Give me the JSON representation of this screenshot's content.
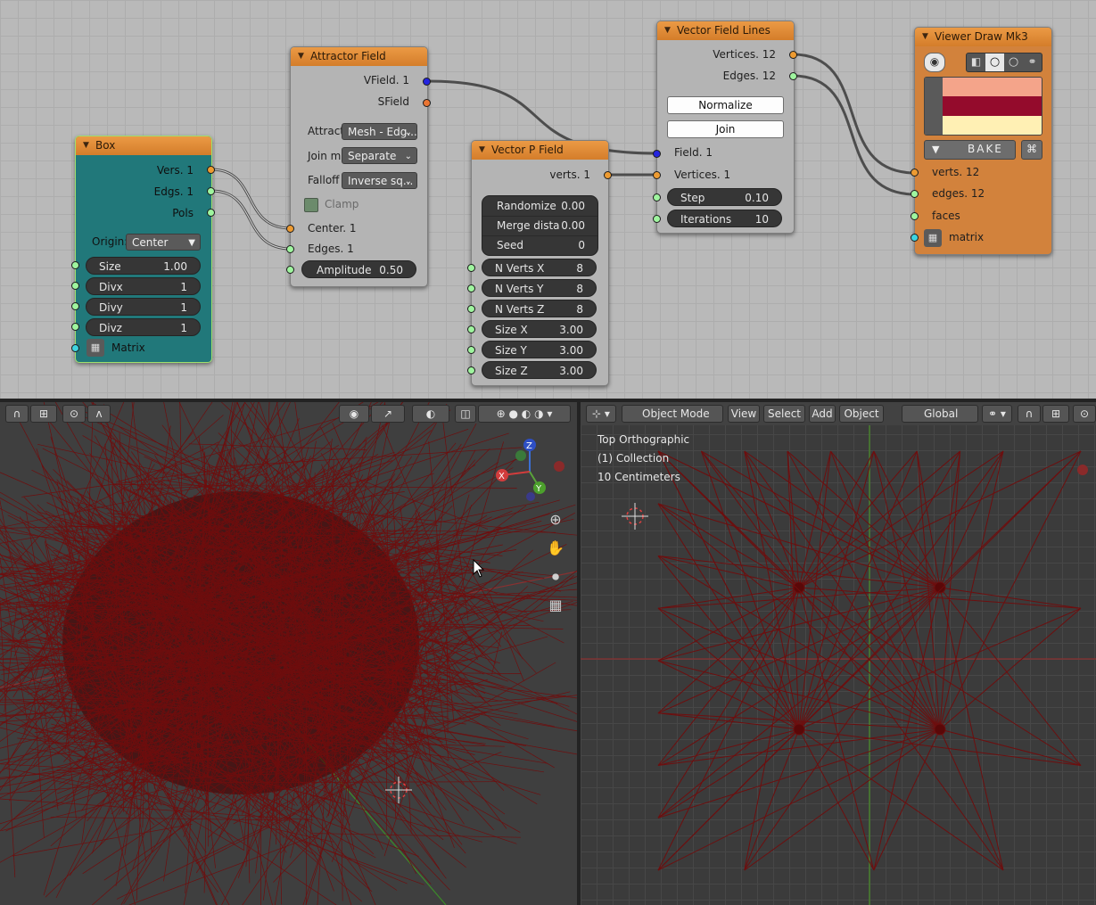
{
  "colors": {
    "node_header": "#e0893a",
    "box_body": "#21787a",
    "viewer_body": "#d2823c",
    "wire": "#5a5a5a",
    "mesh_wire": "#6e0e0e",
    "swatch_vertex": "#f4a48a",
    "swatch_edge": "#940b2c",
    "swatch_face": "#fff0b4"
  },
  "nodes": {
    "box": {
      "title": "Box",
      "outputs": [
        "Vers. 1",
        "Edgs. 1",
        "Pols"
      ],
      "origin_label": "Origin:",
      "origin_value": "Center",
      "fields": [
        {
          "label": "Size",
          "value": "1.00"
        },
        {
          "label": "Divx",
          "value": "1"
        },
        {
          "label": "Divy",
          "value": "1"
        },
        {
          "label": "Divz",
          "value": "1"
        }
      ],
      "matrix_label": "Matrix"
    },
    "attractor": {
      "title": "Attractor Field",
      "outputs": [
        "VField. 1",
        "SField"
      ],
      "attract_label": "Attract",
      "attract_value": "Mesh - Edg...",
      "join_label": "Join m",
      "join_value": "Separate",
      "falloff_label": "Falloff",
      "falloff_value": "Inverse sq...",
      "clamp_label": "Clamp",
      "inputs": [
        "Center. 1",
        "Edges. 1"
      ],
      "amplitude_label": "Amplitude",
      "amplitude_value": "0.50"
    },
    "vpfield": {
      "title": "Vector P Field",
      "output": "verts. 1",
      "props": [
        {
          "label": "Randomize",
          "value": "0.00"
        },
        {
          "label": "Merge dista",
          "value": "0.00"
        },
        {
          "label": "Seed",
          "value": "0"
        }
      ],
      "fields": [
        {
          "label": "N Verts X",
          "value": "8"
        },
        {
          "label": "N Verts Y",
          "value": "8"
        },
        {
          "label": "N Verts Z",
          "value": "8"
        },
        {
          "label": "Size X",
          "value": "3.00"
        },
        {
          "label": "Size Y",
          "value": "3.00"
        },
        {
          "label": "Size Z",
          "value": "3.00"
        }
      ]
    },
    "vflines": {
      "title": "Vector Field Lines",
      "outputs": [
        "Vertices. 12",
        "Edges. 12"
      ],
      "normalize_label": "Normalize",
      "join_label": "Join",
      "inputs": [
        "Field. 1",
        "Vertices. 1"
      ],
      "fields": [
        {
          "label": "Step",
          "value": "0.10"
        },
        {
          "label": "Iterations",
          "value": "10"
        }
      ]
    },
    "viewer": {
      "title": "Viewer Draw Mk3",
      "bake_label": "BAKE",
      "inputs": [
        "verts. 12",
        "edges. 12",
        "faces",
        "matrix"
      ]
    }
  },
  "viewport_right": {
    "mode": "Object Mode",
    "menus": [
      "View",
      "Select",
      "Add",
      "Object"
    ],
    "transform": "Global",
    "overlay": [
      "Top Orthographic",
      "(1) Collection",
      "10 Centimeters"
    ]
  },
  "gizmo": {
    "x": "X",
    "y": "Y",
    "z": "Z"
  },
  "icons": [
    "eye-icon",
    "zoom-icon",
    "hand-icon",
    "camera-icon",
    "grid-icon",
    "cursor-icon"
  ]
}
